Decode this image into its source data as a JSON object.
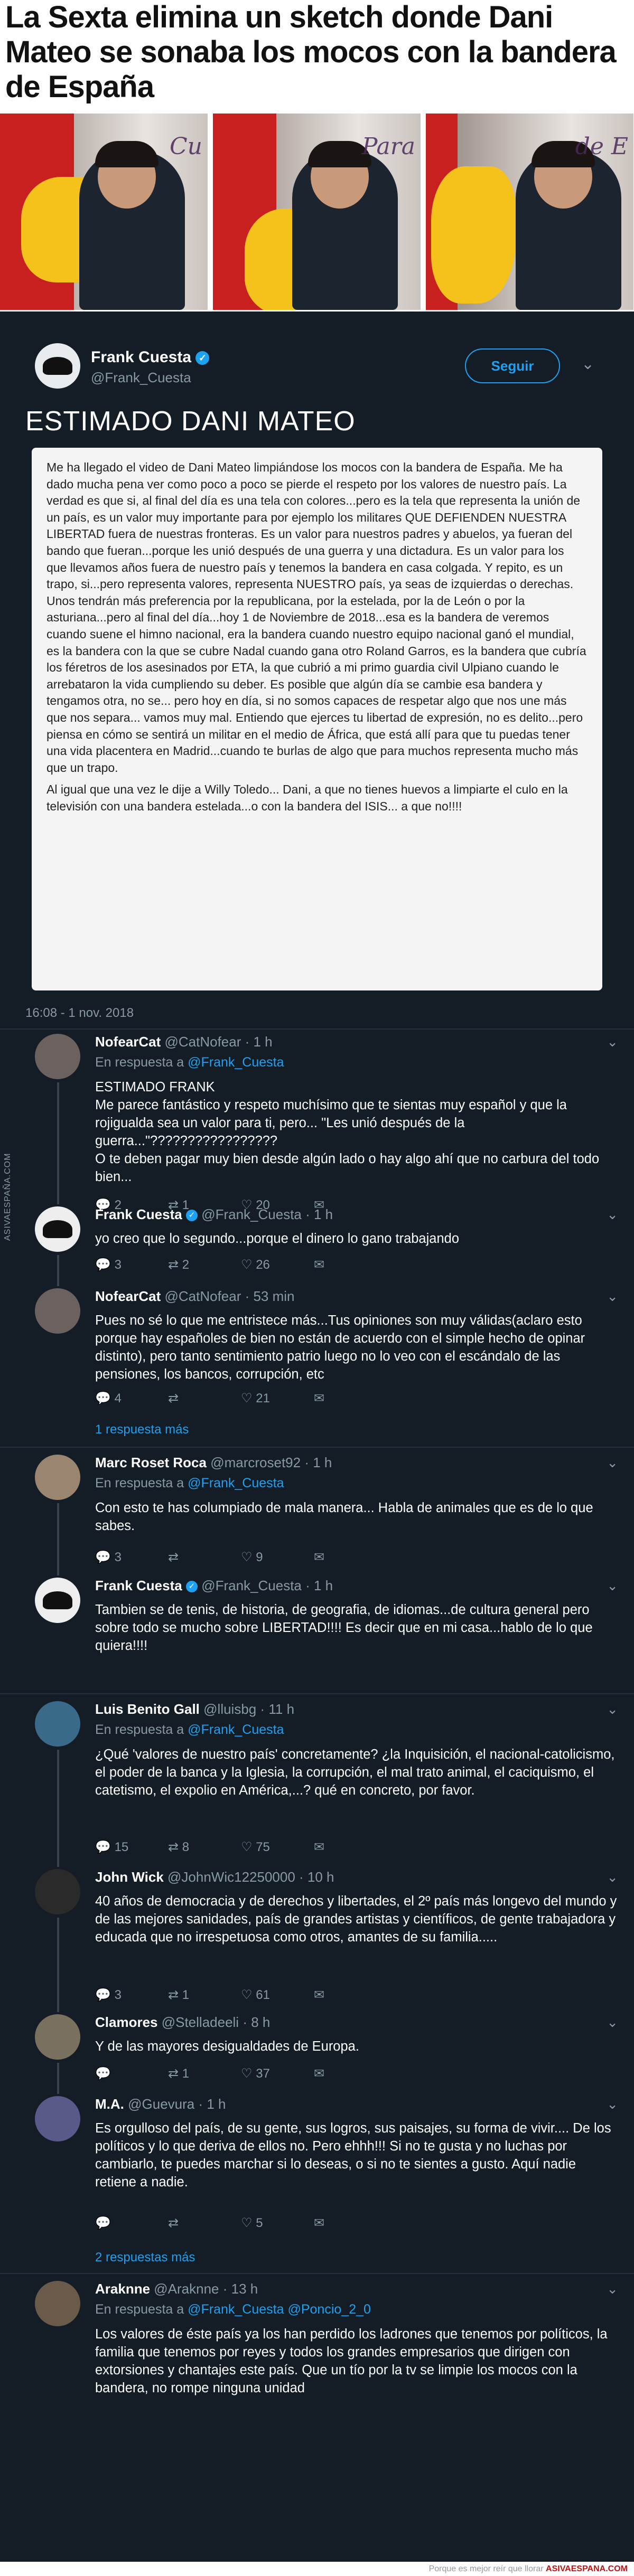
{
  "headline": "La Sexta elimina un sketch donde Dani Mateo se sonaba los mocos con la bandera de España",
  "photos": {
    "wall_text": [
      "Cu",
      "Para",
      "de E"
    ]
  },
  "main_tweet": {
    "name": "Frank Cuesta",
    "handle": "@Frank_Cuesta",
    "follow_label": "Seguir",
    "caret": "⌄",
    "heading": "ESTIMADO DANI MATEO",
    "letter_p1": "Me ha llegado el video de Dani Mateo limpiándose los mocos con la bandera de España. Me ha dado mucha pena ver como poco a poco se pierde el respeto por los valores de nuestro país. La verdad es que si, al final del día es una tela con colores...pero es la tela que representa la unión de un país, es un valor muy importante para por ejemplo los militares QUE DEFIENDEN NUESTRA LIBERTAD fuera de nuestras fronteras. Es un valor para nuestros padres y abuelos, ya fueran del bando que fueran...porque les unió después de una guerra y una dictadura. Es un valor para los que llevamos años fuera de nuestro país y tenemos la bandera en casa colgada. Y repito, es un trapo, si...pero representa valores, representa NUESTRO país, ya seas de izquierdas o derechas. Unos tendrán más preferencia por la republicana, por la estelada, por la de León o por la asturiana...pero al final del día...hoy 1 de Noviembre de 2018...esa es la bandera de veremos cuando suene el himno nacional, era la bandera cuando nuestro equipo nacional ganó el mundial, es la bandera con la que se cubre Nadal cuando gana otro Roland Garros, es la bandera que cubría los féretros de los asesinados por ETA, la que cubrió a mi primo guardia civil Ulpiano cuando le arrebataron la vida cumpliendo su deber. Es posible que algún día se cambie esa bandera y tengamos otra, no se... pero hoy en día, si no somos capaces de respetar algo que nos une más que nos separa... vamos muy mal. Entiendo que ejerces tu libertad de expresión, no es delito...pero piensa en cómo se sentirá un militar en el medio de África, que está allí para que tu puedas tener una vida placentera en Madrid...cuando te burlas de algo que para muchos representa mucho más que un trapo.",
    "letter_p2": "Al igual que una vez le dije a Willy Toledo... Dani, a que no tienes huevos a limpiarte el culo en la televisión con una bandera estelada...o con la bandera del ISIS... a que no!!!!",
    "timestamp": "16:08 - 1 nov. 2018"
  },
  "watermark": "ASIVAESPAÑA.COM",
  "replies": [
    {
      "name": "NofearCat",
      "handle": "@CatNofear",
      "time": "· 1 h",
      "in_reply": "En respuesta a",
      "to": "@Frank_Cuesta",
      "body": [
        "ESTIMADO FRANK",
        "Me parece fantástico y respeto muchísimo que te sientas muy español y que la rojigualda sea un valor para ti, pero... \"Les unió después de la guerra...\"?????????????????",
        "O te deben pagar muy bien desde algún lado o hay algo ahí que no carbura del todo bien..."
      ],
      "replies": "2",
      "retweets": "1",
      "likes": "20"
    },
    {
      "name": "Frank Cuesta",
      "handle": "@Frank_Cuesta",
      "time": "· 1 h",
      "in_reply": "",
      "to": "",
      "body": [
        "yo creo que lo segundo...porque el dinero lo gano trabajando"
      ],
      "replies": "3",
      "retweets": "2",
      "likes": "26"
    },
    {
      "name": "NofearCat",
      "handle": "@CatNofear",
      "time": "· 53 min",
      "in_reply": "",
      "to": "",
      "body": [
        "Pues no sé lo que me entristece más...Tus opiniones son muy válidas(aclaro esto porque hay españoles de bien no están de acuerdo con el simple hecho de opinar distinto), pero tanto sentimiento patrio luego no lo veo con el escándalo de las pensiones, los bancos, corrupción, etc"
      ],
      "replies": "4",
      "retweets": "",
      "likes": "21",
      "more": "1 respuesta más"
    },
    {
      "name": "Marc Roset Roca",
      "handle": "@marcroset92",
      "time": "· 1 h",
      "in_reply": "En respuesta a",
      "to": "@Frank_Cuesta",
      "body": [
        "Con esto te has columpiado de mala manera... Habla de animales que es de lo que sabes."
      ],
      "replies": "3",
      "retweets": "",
      "likes": "9"
    },
    {
      "name": "Frank Cuesta",
      "handle": "@Frank_Cuesta",
      "time": "· 1 h",
      "in_reply": "",
      "to": "",
      "body": [
        "Tambien se de tenis, de historia, de geografia, de idiomas...de cultura general pero sobre todo se mucho sobre LIBERTAD!!!! Es decir que en mi casa...hablo de lo que quiera!!!!"
      ],
      "replies": "",
      "retweets": "",
      "likes": ""
    },
    {
      "name": "Luis Benito Gall",
      "handle": "@lluisbg",
      "time": "· 11 h",
      "in_reply": "En respuesta a",
      "to": "@Frank_Cuesta",
      "body": [
        "¿Qué 'valores de nuestro país' concretamente? ¿la Inquisición, el nacional-catolicismo, el poder de la banca y la Iglesia, la corrupción, el mal trato animal, el caciquismo, el catetismo, el expolio en América,...? qué en concreto, por favor."
      ],
      "replies": "15",
      "retweets": "8",
      "likes": "75"
    },
    {
      "name": "John Wick",
      "handle": "@JohnWic12250000",
      "time": "· 10 h",
      "in_reply": "",
      "to": "",
      "body": [
        "40 años de democracia y de derechos y libertades, el 2º país más longevo del mundo y de las mejores sanidades, país de grandes artistas y científicos, de gente trabajadora y educada que no irrespetuosa como otros, amantes de su familia....."
      ],
      "replies": "3",
      "retweets": "1",
      "likes": "61"
    },
    {
      "name": "Clamores",
      "handle": "@Stelladeeli",
      "time": "· 8 h",
      "in_reply": "",
      "to": "",
      "body": [
        "Y de las mayores desigualdades de Europa."
      ],
      "replies": "",
      "retweets": "1",
      "likes": "37"
    },
    {
      "name": "M.A.",
      "handle": "@Guevura",
      "time": "· 1 h",
      "in_reply": "",
      "to": "",
      "body": [
        "Es orgulloso del país, de su gente, sus logros, sus paisajes, su forma de vivir.... De los políticos y lo que deriva de ellos no. Pero ehhh!!! Si no te gusta y no luchas por cambiarlo, te puedes marchar si lo deseas, o si no te sientes a gusto. Aquí nadie retiene a nadie."
      ],
      "replies": "",
      "retweets": "",
      "likes": "5",
      "more": "2 respuestas más"
    },
    {
      "name": "Araknne",
      "handle": "@Araknne",
      "time": "· 13 h",
      "in_reply": "En respuesta a",
      "to": "@Frank_Cuesta @Poncio_2_0",
      "body": [
        "Los valores de éste país ya los han perdido los ladrones que tenemos por políticos, la familia que tenemos por reyes y todos los grandes empresarios que dirigen con extorsiones y chantajes este país. Que un tío por la tv se limpie los mocos con la bandera, no rompe ninguna unidad"
      ],
      "replies": "",
      "retweets": "",
      "likes": ""
    }
  ],
  "footer": {
    "text": "Porque es mejor reír que llorar",
    "brand": "ASIVAESPANA.COM"
  },
  "colors": {
    "bg": "#141d26",
    "accent": "#1da1f2",
    "muted": "#8899a6"
  }
}
